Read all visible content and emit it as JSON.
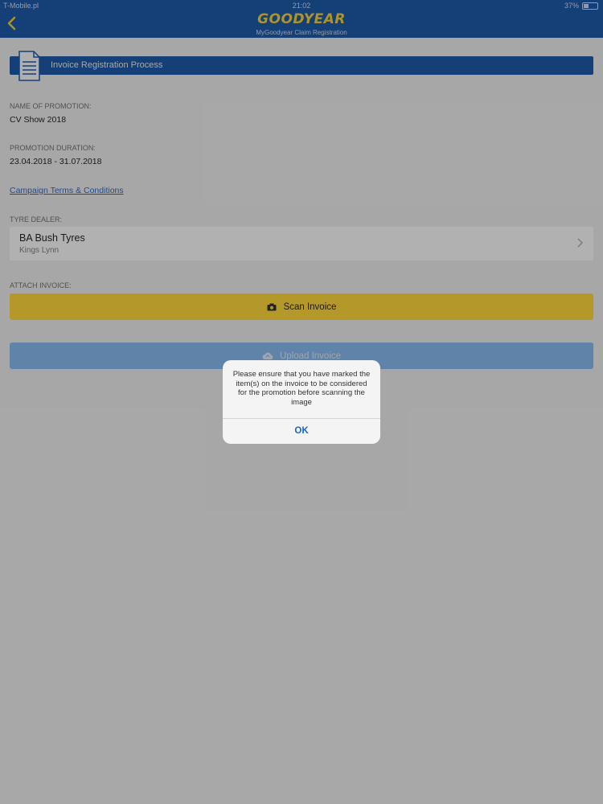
{
  "status_bar": {
    "carrier": "T-Mobile.pl",
    "time": "21:02",
    "battery": "37%",
    "battery_level": 0.37
  },
  "nav": {
    "brand": "GOODYEAR",
    "subtitle": "MyGoodyear Claim Registration",
    "back_icon": "chevron-left-icon"
  },
  "banner": {
    "title": "Invoice Registration Process",
    "icon": "document-icon"
  },
  "promotion": {
    "name_label": "NAME OF PROMOTION:",
    "name_value": "CV Show 2018",
    "duration_label": "PROMOTION DURATION:",
    "duration_value": "23.04.2018 - 31.07.2018",
    "terms_link": "Campaign Terms & Conditions"
  },
  "dealer": {
    "label": "TYRE DEALER:",
    "name": "BA Bush Tyres",
    "city": "Kings Lynn"
  },
  "attach": {
    "label": "ATTACH INVOICE:",
    "scan_label": "Scan Invoice",
    "scan_icon": "camera-icon",
    "upload_label": "Upload Invoice",
    "upload_icon": "cloud-upload-icon"
  },
  "alert": {
    "message": "Please ensure that you have marked the item(s) on the invoice to be considered for the promotion before scanning the image",
    "ok_label": "OK"
  },
  "colors": {
    "nav_blue": "#0b4da2",
    "accent_yellow": "#ffd52b",
    "upload_blue": "#7eb4ee",
    "link_blue": "#1d5cc4"
  }
}
